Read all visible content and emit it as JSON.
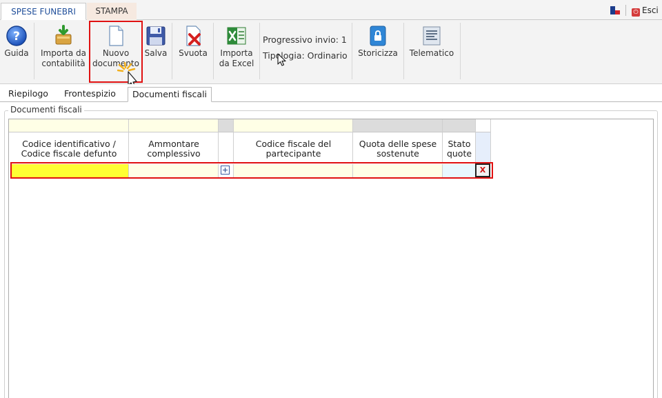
{
  "top_tabs": [
    {
      "label": "SPESE FUNEBRI",
      "active": true
    },
    {
      "label": "STAMPA",
      "active": false
    }
  ],
  "top_right": {
    "exit_label": "Esci",
    "flag_icon": "flag-icon",
    "exit_icon": "power-icon"
  },
  "ribbon": {
    "buttons": [
      {
        "id": "guida",
        "label": "Guida",
        "icon": "help-icon"
      },
      {
        "id": "importa_contabilita",
        "label": "Importa da\ncontabilità",
        "icon": "import-accounting-icon"
      },
      {
        "id": "nuovo_documento",
        "label": "Nuovo\ndocumento",
        "icon": "new-document-icon"
      },
      {
        "id": "salva",
        "label": "Salva",
        "icon": "save-icon"
      },
      {
        "id": "svuota",
        "label": "Svuota",
        "icon": "clear-document-icon"
      },
      {
        "id": "importa_excel",
        "label": "Importa\nda Excel",
        "icon": "excel-icon"
      },
      {
        "id": "storicizza",
        "label": "Storicizza",
        "icon": "lock-archive-icon"
      },
      {
        "id": "telematico",
        "label": "Telematico",
        "icon": "telematic-icon"
      }
    ],
    "info": {
      "progressivo": "Progressivo invio: 1",
      "tipologia": "Tipologia: Ordinario"
    }
  },
  "sub_tabs": [
    {
      "label": "Riepilogo",
      "active": false
    },
    {
      "label": "Frontespizio",
      "active": false
    },
    {
      "label": "Documenti fiscali",
      "active": true
    }
  ],
  "section": {
    "legend": "Documenti fiscali"
  },
  "table": {
    "columns": [
      {
        "header": "Codice identificativo /\nCodice fiscale defunto"
      },
      {
        "header": "Ammontare\ncomplessivo"
      },
      {
        "header": ""
      },
      {
        "header": "Codice fiscale del\npartecipante"
      },
      {
        "header": "Quota delle spese\nsostenute"
      },
      {
        "header": "Stato\nquote"
      }
    ],
    "rows": [
      {
        "codice": "",
        "ammontare": "",
        "cf_partecipante": "",
        "quota": "",
        "stato": ""
      }
    ],
    "delete_label": "X",
    "expand_icon": "plus-box-icon"
  },
  "colors": {
    "highlight": "#e01010",
    "active_tab_text": "#1f4e9a",
    "yellow_cell": "#ffff33",
    "input_cell": "#ffffe6"
  }
}
